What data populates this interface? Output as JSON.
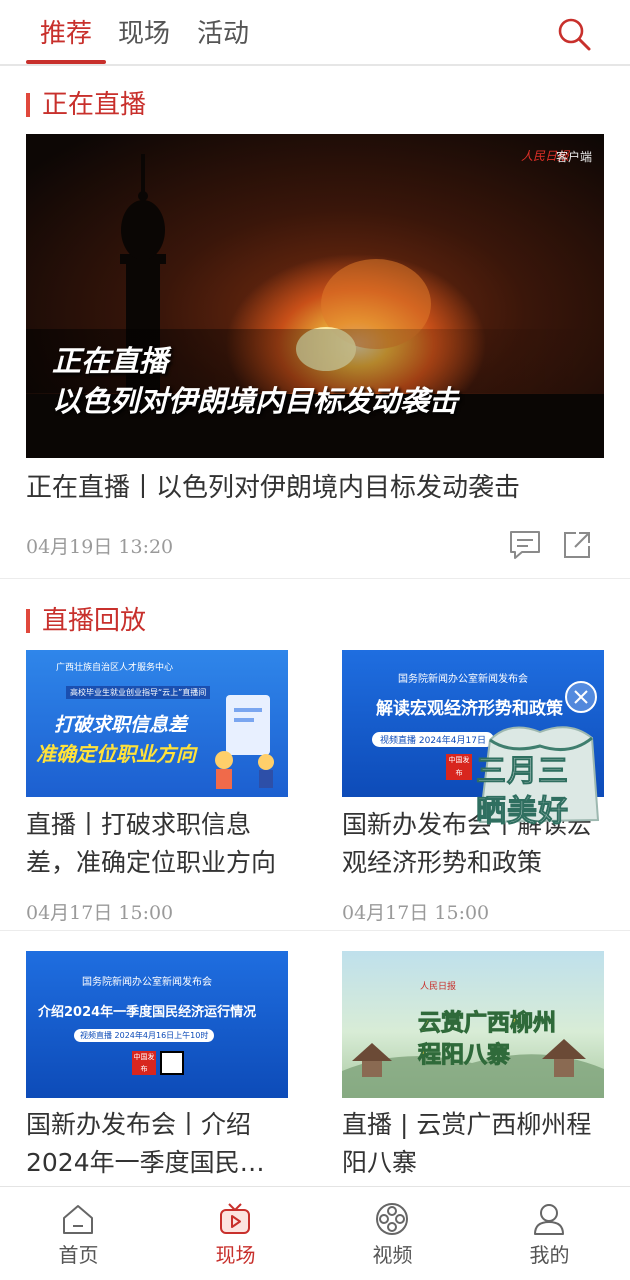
{
  "top_tabs": [
    {
      "label": "推荐",
      "active": true
    },
    {
      "label": "现场",
      "active": false
    },
    {
      "label": "活动",
      "active": false
    }
  ],
  "live_section": {
    "title": "正在直播",
    "card": {
      "overlay_line1": "正在直播",
      "overlay_line2": "以色列对伊朗境内目标发动袭击",
      "watermark_client": "客户端",
      "title": "正在直播丨以色列对伊朗境内目标发动袭击",
      "time": "04月19日 13:20"
    }
  },
  "replay_section": {
    "title": "直播回放",
    "cards": [
      {
        "image_header": "广西壮族自治区人才服务中心",
        "image_banner": "高校毕业生就业创业指导“云上”直播间",
        "image_line1": "打破求职信息差",
        "image_line2": "准确定位职业方向",
        "title": "直播丨打破求职信息差，准确定位职业方向",
        "time": "04月17日 15:00"
      },
      {
        "image_header": "国务院新闻办公室新闻发布会",
        "image_line1": "解读宏观经济形势和政策",
        "image_pill": "视频直播  2024年4月17日",
        "image_badge": "中国发布",
        "title": "国新办发布会丨解读宏观经济形势和政策",
        "time": "04月17日 15:00"
      },
      {
        "image_header": "国务院新闻办公室新闻发布会",
        "image_line1": "介绍2024年一季度国民经济运行情况",
        "image_pill": "视频直播 2024年4月16日上午10时",
        "image_badge": "中国发布",
        "title": "国新办发布会丨介绍2024年一季度国民…",
        "time": ""
      },
      {
        "image_line1": "云赏广西柳州",
        "image_line2": "程阳八寨",
        "title": "直播 | 云赏广西柳州程阳八寨",
        "time": ""
      }
    ]
  },
  "promo": {
    "line1": "三月三",
    "line2": "晒美好"
  },
  "bottom_nav": [
    {
      "label": "首页",
      "icon": "home-icon",
      "active": false
    },
    {
      "label": "现场",
      "icon": "live-tv-icon",
      "active": true
    },
    {
      "label": "视频",
      "icon": "film-reel-icon",
      "active": false
    },
    {
      "label": "我的",
      "icon": "user-icon",
      "active": false
    }
  ],
  "colors": {
    "accent": "#c8302c",
    "text": "#333333",
    "muted": "#9a9a9a"
  }
}
